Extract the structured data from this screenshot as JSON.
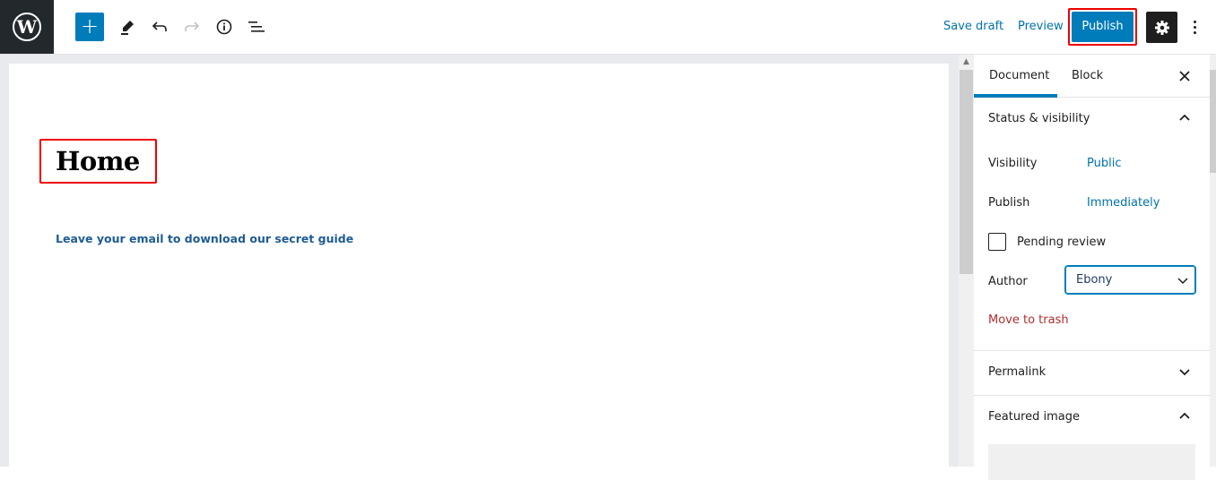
{
  "header": {
    "logo": "W",
    "add_block": "+",
    "icons": [
      "wordpress-logo-icon",
      "plus-icon",
      "pencil-tools-icon",
      "undo-icon",
      "redo-icon",
      "info-icon",
      "list-view-icon",
      "gear-icon",
      "more-vertical-icon"
    ],
    "save_draft": "Save draft",
    "preview": "Preview",
    "publish": "Publish"
  },
  "editor": {
    "title": "Home",
    "paragraph": "Leave your email to download our secret guide"
  },
  "sidebar": {
    "tabs": [
      {
        "label": "Document",
        "active": true
      },
      {
        "label": "Block",
        "active": false
      }
    ],
    "close": "×",
    "status_panel": {
      "title": "Status & visibility",
      "expanded": true,
      "visibility_label": "Visibility",
      "visibility_value": "Public",
      "publish_label": "Publish",
      "publish_value": "Immediately",
      "pending_review_label": "Pending review",
      "pending_review_checked": false,
      "author_label": "Author",
      "author_value": "Ebony",
      "trash_label": "Move to trash"
    },
    "permalink_panel": {
      "title": "Permalink",
      "expanded": false
    },
    "featured_image_panel": {
      "title": "Featured image",
      "expanded": true
    }
  },
  "colors": {
    "accent": "#007cba",
    "link": "#0073aa",
    "danger": "#b32d2e",
    "highlight_box": "#ee0000",
    "logo_bg": "#23282d"
  }
}
